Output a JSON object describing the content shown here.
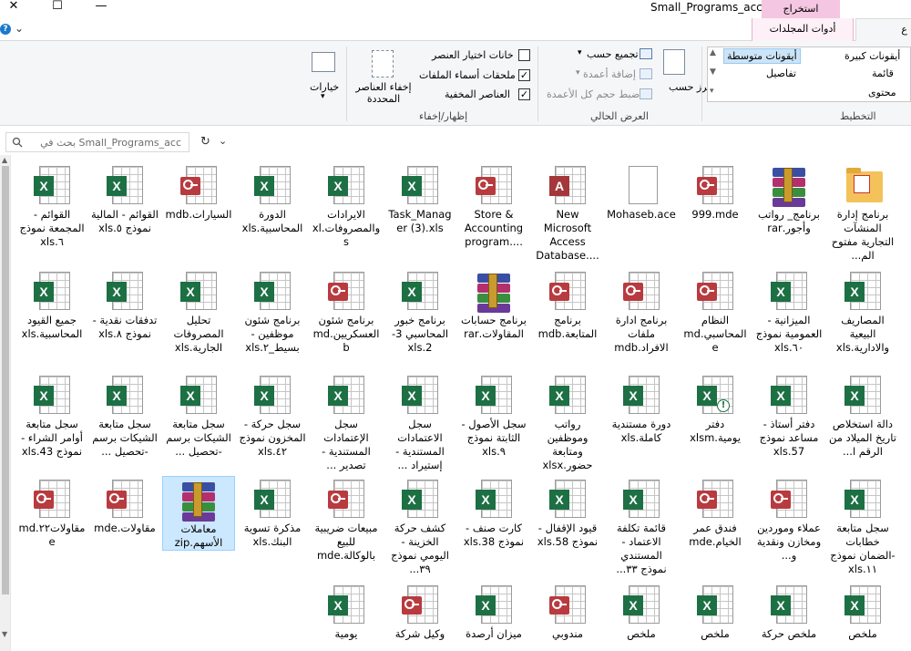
{
  "window": {
    "title": "Small_Programs_acc",
    "minimize": "—",
    "maximize": "☐",
    "close": "✕"
  },
  "tabs": {
    "extract": "استخراج",
    "compressed_tools": "أدوات المجلدات المضغوطة",
    "view_partial": "ع"
  },
  "ribbon": {
    "layout": {
      "group_label": "التخطيط",
      "large_icons": "أيقونات كبيرة",
      "medium_icons": "أيقونات متوسطة",
      "list": "قائمة",
      "details": "تفاصيل",
      "content": "محتوى"
    },
    "current_view": {
      "group_label": "العرض الحالي",
      "sort_by": "فرز حسب",
      "group_by": "تجميع حسب",
      "add_columns": "إضافة أعمدة",
      "size_columns": "ضبط حجم كل الأعمدة"
    },
    "show_hide": {
      "group_label": "إظهار/إخفاء",
      "item_checkboxes": "خانات اختيار العنصر",
      "file_extensions": "ملحقات أسماء الملفات",
      "hidden_items": "العناصر المخفية",
      "hide_selected": "إخفاء العناصر المحددة",
      "options": "خيارات"
    }
  },
  "address": {
    "search_placeholder": "بحث في Small_Programs_acc",
    "refresh": "↻",
    "dropdown": "⌄"
  },
  "files": [
    {
      "name": "برنامج إدارة المنشآت التجارية مفتوح الم...",
      "icon": "folder-pdf"
    },
    {
      "name": "برنامج_ رواتب وأجور.rar",
      "icon": "rar"
    },
    {
      "name": "999.mde",
      "icon": "mde"
    },
    {
      "name": "Mohaseb.ace",
      "icon": "plain"
    },
    {
      "name": "New Microsoft Access Database....",
      "icon": "access"
    },
    {
      "name": "Store & Accounting program....",
      "icon": "mdb"
    },
    {
      "name": "Task_Manager (3).xls",
      "icon": "excel"
    },
    {
      "name": "الايرادات والمصروفات.xls",
      "icon": "excel"
    },
    {
      "name": "الدورة المحاسبية.xls",
      "icon": "excel"
    },
    {
      "name": "السيارات.mdb",
      "icon": "mdb"
    },
    {
      "name": "القوائم - المالية نموذج ٥.xls",
      "icon": "excel"
    },
    {
      "name": "القوائم - المجمعة نموذج ٦.xls",
      "icon": "excel"
    },
    {
      "name": "المصاريف البيعية والادارية.xls",
      "icon": "excel"
    },
    {
      "name": "الميزانية - العمومية نموذج ٦٠.xls",
      "icon": "excel"
    },
    {
      "name": "النظام المحاسبي.mde",
      "icon": "mde"
    },
    {
      "name": "برنامج ادارة ملفات الافراد.mdb",
      "icon": "mdb"
    },
    {
      "name": "برنامج المتابعة.mdb",
      "icon": "mdb"
    },
    {
      "name": "برنامج حسابات المقاولات.rar",
      "icon": "rar"
    },
    {
      "name": "برنامج خبور المحاسبي 3-2.xls",
      "icon": "excel"
    },
    {
      "name": "برنامج شئون العسكريين.mdb",
      "icon": "mdb"
    },
    {
      "name": "برنامج شئون موظفين - بسيط_٢.xls",
      "icon": "excel"
    },
    {
      "name": "تحليل المصروفات الجارية.xls",
      "icon": "excel"
    },
    {
      "name": "تدفقات نقدية - نموذج ٨.xls",
      "icon": "excel"
    },
    {
      "name": "جميع القيود المحاسبية.xls",
      "icon": "excel"
    },
    {
      "name": "دالة استخلاص تاريخ الميلاد من الرقم ا...",
      "icon": "excel"
    },
    {
      "name": "دفتر أستاذ - مساعد نموذج 57.xls",
      "icon": "excel"
    },
    {
      "name": "دفتر يومية.xlsm",
      "icon": "xlsm"
    },
    {
      "name": "دورة مستندية كاملة.xls",
      "icon": "excel"
    },
    {
      "name": "رواتب وموظفين ومتابعة حضور.xlsx",
      "icon": "xlsx"
    },
    {
      "name": "سجل الأصول - الثابتة نموذج ٩.xls",
      "icon": "excel"
    },
    {
      "name": "سجل الاعتمادات المستندية - إستيراد ...",
      "icon": "excel"
    },
    {
      "name": "سجل الإعتمادات المستندية - تصدير ...",
      "icon": "excel"
    },
    {
      "name": "سجل حركة - المخزون نموذج ٤٢.xls",
      "icon": "excel"
    },
    {
      "name": "سجل متابعة الشيكات برسم -تحصيل ...",
      "icon": "excel"
    },
    {
      "name": "سجل متابعة الشيكات برسم -تحصيل ...",
      "icon": "excel"
    },
    {
      "name": "سجل متابعة أوامر الشراء - نموذج 43.xls",
      "icon": "excel"
    },
    {
      "name": "سجل متابعة خطابات -الضمان نموذج ١١.xls",
      "icon": "excel"
    },
    {
      "name": "عملاء وموردين ومخازن ونقدية و...",
      "icon": "mde"
    },
    {
      "name": "فندق عمر الخيام.mde",
      "icon": "mde"
    },
    {
      "name": "قائمة تكلفة الاعتماد - المستندي نموذج ٣٣...",
      "icon": "excel"
    },
    {
      "name": "قيود الإقفال - نموذج 58.xls",
      "icon": "excel"
    },
    {
      "name": "كارت صنف - نموذج 38.xls",
      "icon": "excel"
    },
    {
      "name": "كشف حركة الخزينة - اليومي نموذج ٣٩...",
      "icon": "excel"
    },
    {
      "name": "مبيعات ضريبية للبيع بالوكالة.mde",
      "icon": "mde"
    },
    {
      "name": "مذكرة تسوية البنك.xls",
      "icon": "excel"
    },
    {
      "name": "معاملات الأسهم.zip",
      "icon": "rar",
      "selected": true
    },
    {
      "name": "مقاولات.mde",
      "icon": "mde"
    },
    {
      "name": "مقاولات٢٢.mde",
      "icon": "mde"
    },
    {
      "name": "ملخص",
      "icon": "excel"
    },
    {
      "name": "ملخص حركة",
      "icon": "excel"
    },
    {
      "name": "ملخص",
      "icon": "excel"
    },
    {
      "name": "ملخص",
      "icon": "excel"
    },
    {
      "name": "مندوبي",
      "icon": "mdb"
    },
    {
      "name": "ميزان أرصدة",
      "icon": "excel"
    },
    {
      "name": "وكيل شركة",
      "icon": "mdb"
    },
    {
      "name": "يومية",
      "icon": "excel"
    }
  ]
}
